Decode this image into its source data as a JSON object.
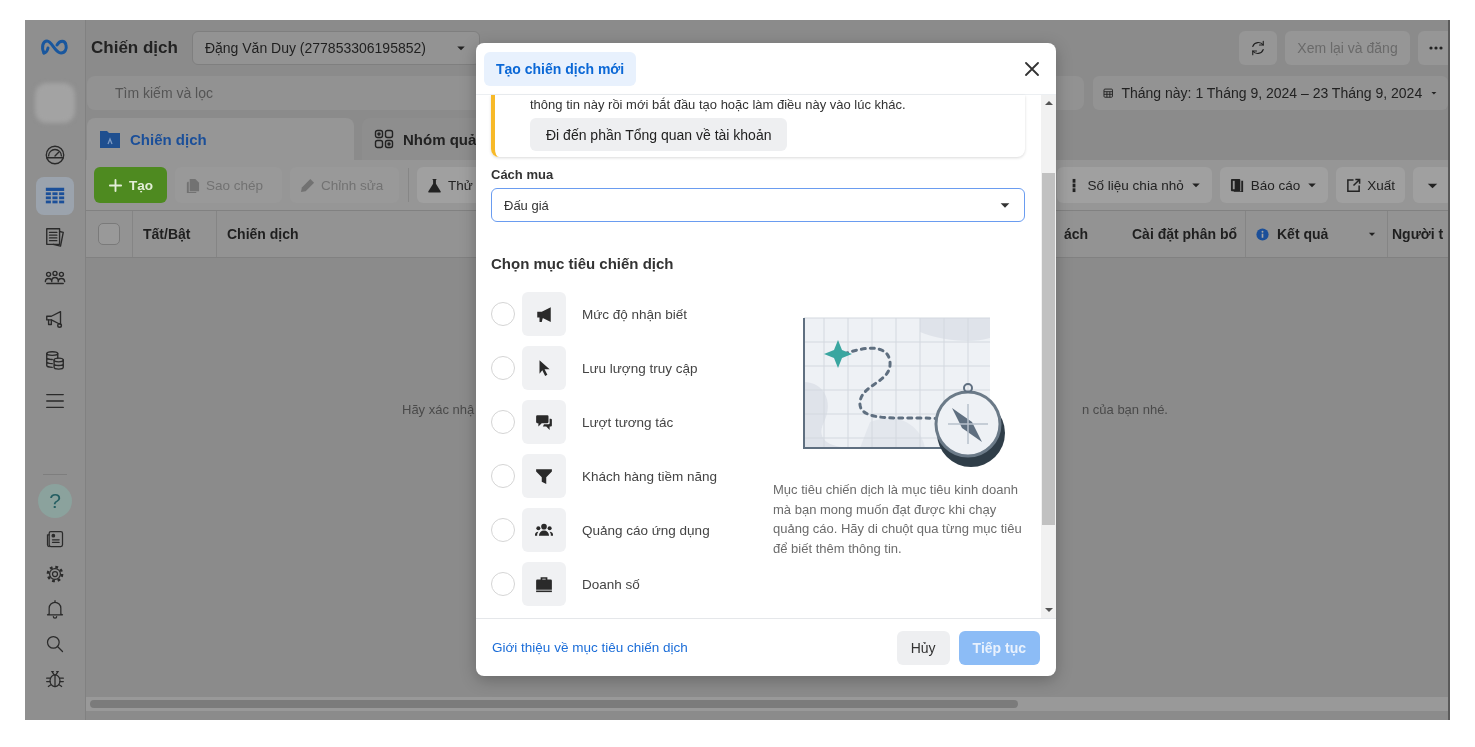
{
  "app": {
    "sidebar": {
      "items": [
        {
          "kind": "gauge",
          "selected": false
        },
        {
          "kind": "table",
          "selected": true
        },
        {
          "kind": "pages",
          "selected": false
        },
        {
          "kind": "people",
          "selected": false
        },
        {
          "kind": "megaphone",
          "selected": false
        },
        {
          "kind": "coins",
          "selected": false
        },
        {
          "kind": "menu",
          "selected": false
        }
      ],
      "bottom_items": [
        {
          "kind": "help",
          "glyph": "?"
        },
        {
          "kind": "news"
        },
        {
          "kind": "settings"
        },
        {
          "kind": "bell"
        },
        {
          "kind": "search"
        },
        {
          "kind": "bug"
        }
      ]
    },
    "title": "Chiến dịch",
    "account_selector": {
      "value": "Đặng Văn Duy (277853306195852)"
    },
    "header_actions": [
      {
        "kind": "refresh"
      },
      {
        "kind": "text",
        "label": "Xem lại và đăng",
        "disabled": true
      },
      {
        "kind": "more"
      }
    ],
    "search": {
      "placeholder": "Tìm kiếm và lọc"
    },
    "date_range": {
      "label": "Tháng này: 1 Tháng 9, 2024 – 23 Tháng 9, 2024"
    },
    "tabs": [
      {
        "kind": "campaign",
        "label": "Chiến dịch",
        "selected": true
      },
      {
        "kind": "adset",
        "label": "Nhóm quả",
        "selected": false
      }
    ],
    "toolbar_left": [
      {
        "kind": "create",
        "label": "Tạo",
        "disabled": false
      },
      {
        "kind": "copy",
        "label": "Sao chép",
        "disabled": true
      },
      {
        "kind": "edit",
        "label": "Chỉnh sửa",
        "disabled": true
      },
      {
        "kind": "test",
        "label": "Thử",
        "disabled": false
      }
    ],
    "toolbar_right": [
      {
        "kind": "breakdown",
        "label": "Số liệu chia nhỏ"
      },
      {
        "kind": "reports",
        "label": "Báo cáo"
      },
      {
        "kind": "export",
        "label": "Xuất"
      },
      {
        "kind": "caret"
      }
    ],
    "table": {
      "columns": [
        {
          "kind": "checkbox",
          "checked": false
        },
        {
          "kind": "plain",
          "label": "Tất/Bật"
        },
        {
          "kind": "wide",
          "label": "Chiến dịch"
        },
        {
          "kind": "plain",
          "label": "ách"
        },
        {
          "kind": "right",
          "label": "Cài đặt phân bổ"
        },
        {
          "kind": "metric",
          "label": "Kết quả"
        },
        {
          "kind": "plain",
          "label": "Người t"
        }
      ],
      "empty_state": {
        "left_text": "Hãy xác nhậ",
        "right_text": "n của bạn nhé."
      }
    }
  },
  "modal": {
    "tab": {
      "label": "Tạo chiến dịch mới",
      "selected": true
    },
    "notice": {
      "text": "thông tin này rồi mới bắt đầu tạo hoặc làm điều này vào lúc khác.",
      "button": "Đi đến phần Tổng quan về tài khoản"
    },
    "buying_type": {
      "label": "Cách mua",
      "value": "Đấu giá"
    },
    "objectives_title": "Chọn mục tiêu chiến dịch",
    "objectives": [
      {
        "kind": "awareness",
        "label": "Mức độ nhận biết",
        "selected": false
      },
      {
        "kind": "traffic",
        "label": "Lưu lượng truy cập",
        "selected": false
      },
      {
        "kind": "engagement",
        "label": "Lượt tương tác",
        "selected": false
      },
      {
        "kind": "leads",
        "label": "Khách hàng tiềm năng",
        "selected": false
      },
      {
        "kind": "app",
        "label": "Quảng cáo ứng dụng",
        "selected": false
      },
      {
        "kind": "sales",
        "label": "Doanh số",
        "selected": false
      }
    ],
    "description": "Mục tiêu chiến dịch là mục tiêu kinh doanh mà bạn mong muốn đạt được khi chạy quảng cáo. Hãy di chuột qua từng mục tiêu để biết thêm thông tin.",
    "footer_link": "Giới thiệu về mục tiêu chiến dịch",
    "buttons": [
      {
        "kind": "secondary",
        "label": "Hủy",
        "disabled": false
      },
      {
        "kind": "primary",
        "label": "Tiếp tục",
        "disabled": true
      }
    ]
  }
}
